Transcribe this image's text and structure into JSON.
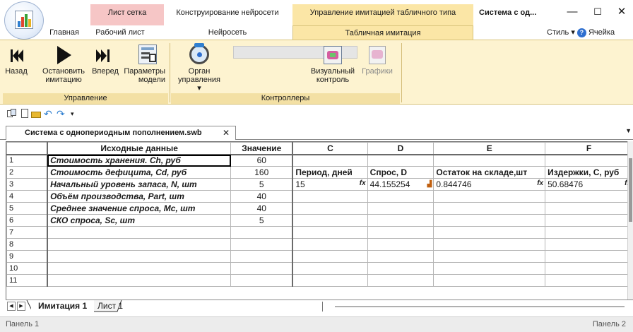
{
  "window": {
    "context_tabs": {
      "grid": "Лист сетка",
      "nn": "Конструирование нейросети",
      "sim": "Управление имитацией табличного типа"
    },
    "doc_title": "Система с од...",
    "controls": {
      "minimize": "—",
      "maximize": "☐",
      "close": "✕"
    }
  },
  "tabs": {
    "home": "Главная",
    "sheet": "Рабочий лист",
    "nn": "Нейросеть",
    "sim": "Табличная имитация",
    "style": "Стиль ▾",
    "cell": "Ячейка"
  },
  "ribbon": {
    "control_group": {
      "label": "Управление",
      "back": "Назад",
      "stop": [
        "Остановить",
        "имитацию"
      ],
      "forward": "Вперед",
      "params": [
        "Параметры",
        "модели"
      ]
    },
    "controllers_group": {
      "label": "Контроллеры",
      "organ": [
        "Орган",
        "управления ▾"
      ],
      "visual": [
        "Визуальный",
        "контроль"
      ],
      "charts": "Графики"
    }
  },
  "document_tab": {
    "label": "Система с однопериодным пополнением.swb",
    "close": "✕"
  },
  "grid": {
    "columns": [
      "Исходные данные",
      "Значение",
      "C",
      "D",
      "E",
      "F"
    ],
    "rows": [
      {
        "n": "1",
        "param": "Стоимость хранения. Ch, руб",
        "value": "60"
      },
      {
        "n": "2",
        "param": "Стоимость дефицита, Cd, руб",
        "value": "160",
        "c": "Период, дней",
        "d": "Спрос, D",
        "e": "Остаток на складе,шт",
        "f": "Издержки, C, руб"
      },
      {
        "n": "3",
        "param": "Начальный уровень запаса, N, шт",
        "value": "5",
        "c": "15",
        "d": "44.155254",
        "e": "0.844746",
        "f": "50.68476"
      },
      {
        "n": "4",
        "param": "Объём производства, Part, шт",
        "value": "40"
      },
      {
        "n": "5",
        "param": "Среднее значение спроса, Mc, шт",
        "value": "40"
      },
      {
        "n": "6",
        "param": "СКО спроса, Sc, шт",
        "value": "5"
      },
      {
        "n": "7"
      },
      {
        "n": "8"
      },
      {
        "n": "9"
      },
      {
        "n": "10"
      },
      {
        "n": "11"
      }
    ],
    "fx_mark": "fx"
  },
  "sheets": {
    "active": "Имитация 1",
    "other": "Лист 1"
  },
  "status": {
    "left": "Панель 1",
    "right": "Панель 2"
  }
}
